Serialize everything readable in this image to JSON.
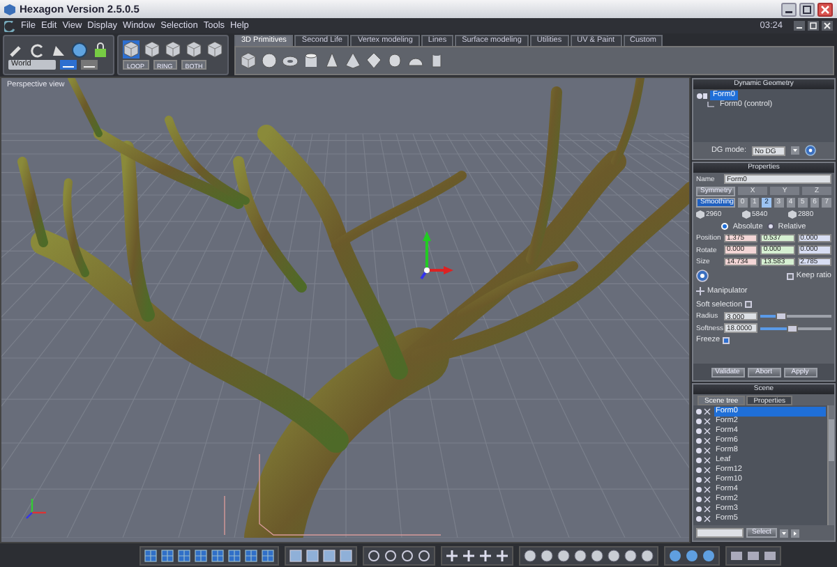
{
  "window": {
    "title": "Hexagon Version 2.5.0.5"
  },
  "menu": [
    "File",
    "Edit",
    "View",
    "Display",
    "Window",
    "Selection",
    "Tools",
    "Help"
  ],
  "clock": "03:24",
  "toolbar": {
    "coordinate_space": "World",
    "small_buttons": [
      "LOOP",
      "RING",
      "BOTH"
    ]
  },
  "tabs": [
    {
      "label": "3D Primitives",
      "selected": true
    },
    {
      "label": "Second Life",
      "selected": false
    },
    {
      "label": "Vertex modeling",
      "selected": false
    },
    {
      "label": "Lines",
      "selected": false
    },
    {
      "label": "Surface modeling",
      "selected": false
    },
    {
      "label": "Utilities",
      "selected": false
    },
    {
      "label": "UV & Paint",
      "selected": false
    },
    {
      "label": "Custom",
      "selected": false
    }
  ],
  "viewport": {
    "label": "Perspective view"
  },
  "dynamic_geometry": {
    "title": "Dynamic Geometry",
    "tree": [
      {
        "label": "Form0",
        "selected": true,
        "children": [
          {
            "label": "Form0 (control)",
            "selected": false
          }
        ]
      }
    ],
    "dg_mode_label": "DG mode:",
    "dg_mode": "No DG"
  },
  "properties": {
    "title": "Properties",
    "name_label": "Name",
    "name": "Form0",
    "symmetry": "Symmetry",
    "axes": [
      "X",
      "Y",
      "Z"
    ],
    "smoothing": "Smoothing",
    "levels": [
      {
        "label": "0",
        "selected": false
      },
      {
        "label": "1",
        "selected": false
      },
      {
        "label": "2",
        "selected": true
      },
      {
        "label": "3",
        "selected": false
      },
      {
        "label": "4",
        "selected": false
      },
      {
        "label": "5",
        "selected": false
      },
      {
        "label": "6",
        "selected": false
      },
      {
        "label": "7",
        "selected": false
      }
    ],
    "counts": [
      "2960",
      "5840",
      "2880"
    ],
    "modes": [
      {
        "label": "Absolute",
        "selected": true
      },
      {
        "label": "Relative",
        "selected": false
      }
    ],
    "rows": [
      {
        "label": "Position",
        "values": [
          "1.375",
          "0.537",
          "0.000"
        ]
      },
      {
        "label": "Rotate",
        "values": [
          "0.000",
          "0.000",
          "0.000"
        ]
      },
      {
        "label": "Size",
        "values": [
          "14.734",
          "13.583",
          "2.785"
        ]
      }
    ],
    "keep_ratio": {
      "label": "Keep ratio",
      "checked": false
    },
    "manipulator": "Manipulator",
    "soft_selection": {
      "label": "Soft selection",
      "checked": false
    },
    "sliders": [
      {
        "label": "Radius",
        "value": "3.000",
        "level": 0.3
      },
      {
        "label": "Softness",
        "value": "18.0000",
        "level": 0.45
      }
    ],
    "freeze": {
      "label": "Freeze",
      "checked": true
    },
    "buttons": [
      "Validate",
      "Abort",
      "Apply"
    ]
  },
  "scene": {
    "title": "Scene",
    "tabs": [
      {
        "label": "Scene tree",
        "selected": true
      },
      {
        "label": "Properties",
        "selected": false
      }
    ],
    "items": [
      {
        "label": "Form0",
        "selected": true
      },
      {
        "label": "Form2",
        "selected": false
      },
      {
        "label": "Form4",
        "selected": false
      },
      {
        "label": "Form6",
        "selected": false
      },
      {
        "label": "Form8",
        "selected": false
      },
      {
        "label": "Leaf",
        "selected": false
      },
      {
        "label": "Form12",
        "selected": false
      },
      {
        "label": "Form10",
        "selected": false
      },
      {
        "label": "Form4",
        "selected": false
      },
      {
        "label": "Form2",
        "selected": false
      },
      {
        "label": "Form3",
        "selected": false
      },
      {
        "label": "Form5",
        "selected": false
      }
    ],
    "select_button": "Select"
  }
}
